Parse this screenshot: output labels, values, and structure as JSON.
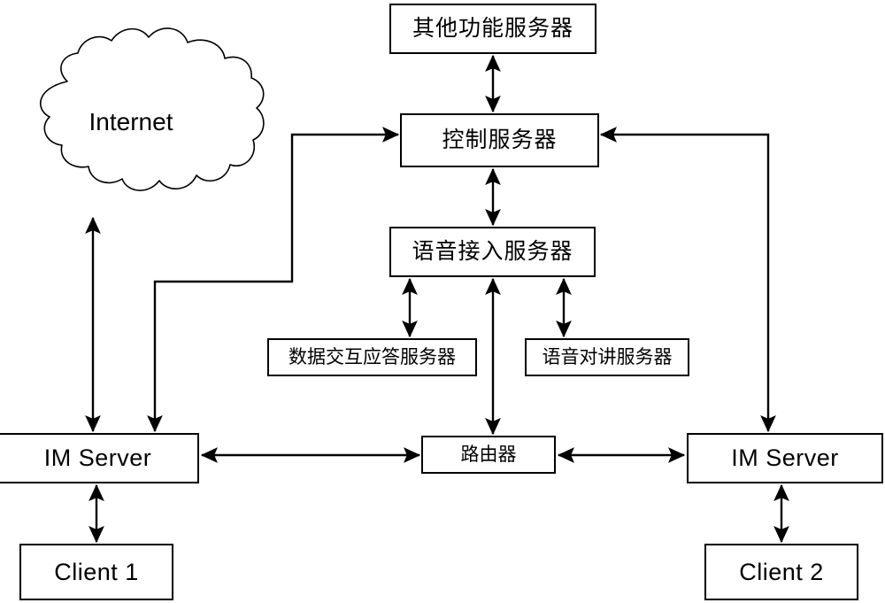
{
  "diagram": {
    "title": "IM system architecture diagram",
    "background_color": "#ffffff",
    "line_color": "#000000",
    "box_fill": "#ffffff"
  },
  "nodes": {
    "cloud": {
      "label": "Internet",
      "shape": "cloud"
    },
    "other_function_server": {
      "label": "其他功能服务器",
      "shape": "rect"
    },
    "control_server": {
      "label": "控制服务器",
      "shape": "rect"
    },
    "voice_access_server": {
      "label": "语音接入服务器",
      "shape": "rect"
    },
    "data_response_server": {
      "label": "数据交互应答服务器",
      "shape": "rect"
    },
    "voice_intercom_server": {
      "label": "语音对讲服务器",
      "shape": "rect"
    },
    "router": {
      "label": "路由器",
      "shape": "rect"
    },
    "im_server_1": {
      "label": "IM Server",
      "shape": "rect"
    },
    "im_server_2": {
      "label": "IM Server",
      "shape": "rect"
    },
    "client_1": {
      "label": "Client 1",
      "shape": "rect"
    },
    "client_2": {
      "label": "Client 2",
      "shape": "rect"
    }
  },
  "connections": [
    {
      "from": "other_function_server",
      "to": "control_server",
      "arrow": "both",
      "orientation": "vertical"
    },
    {
      "from": "control_server",
      "to": "voice_access_server",
      "arrow": "both",
      "orientation": "vertical"
    },
    {
      "from": "voice_access_server",
      "to": "data_response_server",
      "arrow": "both",
      "orientation": "vertical"
    },
    {
      "from": "voice_access_server",
      "to": "voice_intercom_server",
      "arrow": "both",
      "orientation": "vertical"
    },
    {
      "from": "voice_access_server",
      "to": "router",
      "arrow": "both",
      "orientation": "vertical"
    },
    {
      "from": "cloud",
      "to": "im_server_1",
      "arrow": "both",
      "orientation": "vertical"
    },
    {
      "from": "im_server_1",
      "to": "control_server",
      "arrow": "both",
      "orientation": "elbow"
    },
    {
      "from": "im_server_2",
      "to": "control_server",
      "arrow": "both",
      "orientation": "elbow"
    },
    {
      "from": "im_server_1",
      "to": "router",
      "arrow": "both",
      "orientation": "horizontal"
    },
    {
      "from": "router",
      "to": "im_server_2",
      "arrow": "both",
      "orientation": "horizontal"
    },
    {
      "from": "im_server_1",
      "to": "client_1",
      "arrow": "both",
      "orientation": "vertical"
    },
    {
      "from": "im_server_2",
      "to": "client_2",
      "arrow": "both",
      "orientation": "vertical"
    }
  ]
}
